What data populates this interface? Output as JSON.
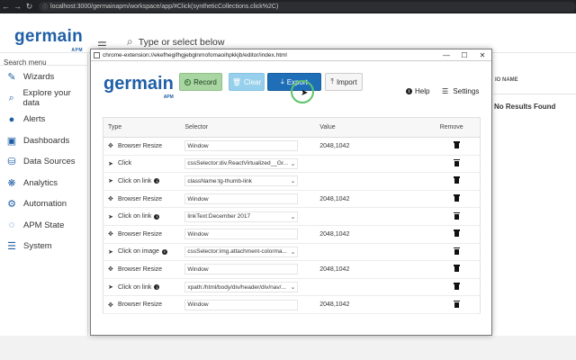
{
  "browser": {
    "url": "localhost:3000/germainapm/workspace/app/#Click(syntheticCollections.click%2C)"
  },
  "header": {
    "logo": "germain",
    "logo_sub": "APM",
    "search_placeholder": "Type or select below"
  },
  "sidebar": {
    "search_placeholder": "Search menu",
    "items": [
      {
        "label": "Wizards",
        "icon": "wand-icon"
      },
      {
        "label": "Explore your data",
        "icon": "search-icon"
      },
      {
        "label": "Alerts",
        "icon": "alert-icon"
      },
      {
        "label": "Dashboards",
        "icon": "dashboard-icon"
      },
      {
        "label": "Data Sources",
        "icon": "database-icon"
      },
      {
        "label": "Analytics",
        "icon": "analytics-icon"
      },
      {
        "label": "Automation",
        "icon": "gear-icon"
      },
      {
        "label": "APM State",
        "icon": "state-icon"
      },
      {
        "label": "System",
        "icon": "sliders-icon"
      }
    ]
  },
  "background": {
    "column_name": "IO NAME",
    "no_results": "No Results Found"
  },
  "popup": {
    "title": "chrome-extension://ekefhegifhgjebglnmofomaoihpkkjb/editor/index.html",
    "window_controls": {
      "minimize": "—",
      "maximize": "☐",
      "close": "✕"
    },
    "logo": "germain",
    "logo_sub": "APM",
    "toolbar": {
      "record": "Record",
      "clear": "Clear",
      "export": "Export",
      "import": "Import",
      "help": "Help",
      "settings": "Settings"
    },
    "table": {
      "headers": {
        "type": "Type",
        "selector": "Selector",
        "value": "Value",
        "remove": "Remove"
      },
      "rows": [
        {
          "type": "Browser Resize",
          "icon": "move",
          "info": false,
          "selector": "Window",
          "dropdown": false,
          "value": "2048,1042"
        },
        {
          "type": "Click",
          "icon": "pointer",
          "info": false,
          "selector": "cssSelector:div.ReactVirtualized__Gr...",
          "dropdown": true,
          "value": ""
        },
        {
          "type": "Click on link",
          "icon": "pointer",
          "info": true,
          "selector": "className:tg-thumb-link",
          "dropdown": true,
          "value": ""
        },
        {
          "type": "Browser Resize",
          "icon": "move",
          "info": false,
          "selector": "Window",
          "dropdown": false,
          "value": "2048,1042"
        },
        {
          "type": "Click on link",
          "icon": "pointer",
          "info": true,
          "selector": "linkText:December 2017",
          "dropdown": true,
          "value": ""
        },
        {
          "type": "Browser Resize",
          "icon": "move",
          "info": false,
          "selector": "Window",
          "dropdown": false,
          "value": "2048,1042"
        },
        {
          "type": "Click on image",
          "icon": "pointer",
          "info": true,
          "selector": "cssSelector:img.attachment-colorma...",
          "dropdown": true,
          "value": ""
        },
        {
          "type": "Browser Resize",
          "icon": "move",
          "info": false,
          "selector": "Window",
          "dropdown": false,
          "value": "2048,1042"
        },
        {
          "type": "Click on link",
          "icon": "pointer",
          "info": true,
          "selector": "xpath:/html/body/div/header/div/nav/...",
          "dropdown": true,
          "value": ""
        },
        {
          "type": "Browser Resize",
          "icon": "move",
          "info": false,
          "selector": "Window",
          "dropdown": false,
          "value": "2048,1042"
        }
      ]
    }
  }
}
